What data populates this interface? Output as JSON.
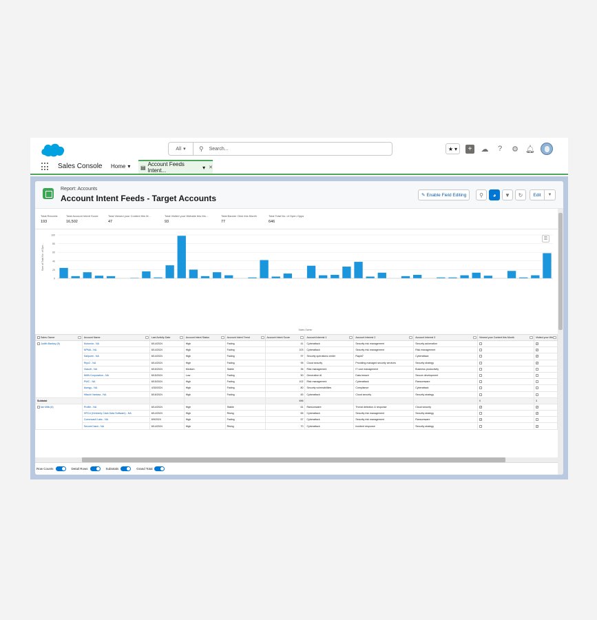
{
  "header": {
    "search_scope": "All",
    "search_placeholder": "Search...",
    "icons": [
      "favorites-star-icon",
      "add-icon",
      "trailhead-icon",
      "help-icon",
      "setup-gear-icon",
      "notification-bell-icon",
      "user-avatar"
    ]
  },
  "nav": {
    "app_name": "Sales Console",
    "home_label": "Home",
    "tab_label": "Account Feeds Intent..."
  },
  "report": {
    "subtitle": "Report: Accounts",
    "title": "Account Intent Feeds - Target Accounts",
    "enable_field_editing": "Enable Field Editing",
    "edit_label": "Edit"
  },
  "summary": [
    {
      "label": "Total Records",
      "value": "193"
    },
    {
      "label": "Total Account Intent Score",
      "value": "16,502"
    },
    {
      "label": "Total Viewed your Content this M...",
      "value": "47"
    },
    {
      "label": "Total Visited your Website this Mo...",
      "value": "93"
    },
    {
      "label": "Total Banner Click this Month",
      "value": "77"
    },
    {
      "label": "Total Total No. of Open Opps",
      "value": "646"
    }
  ],
  "chart_data": {
    "type": "bar",
    "title": "",
    "xlabel": "Sales Owner",
    "ylabel": "Sum of Total No. of Ope...",
    "ylim": [
      0,
      100
    ],
    "yticks": [
      0,
      20,
      40,
      60,
      80,
      100
    ],
    "values": [
      24,
      5,
      14,
      6,
      5,
      0,
      1,
      16,
      2,
      30,
      98,
      20,
      5,
      14,
      7,
      0,
      2,
      42,
      4,
      11,
      0,
      29,
      7,
      8,
      27,
      38,
      4,
      13,
      0,
      5,
      8,
      0,
      2,
      2,
      7,
      13,
      6,
      0,
      17,
      2,
      7,
      58
    ],
    "color": "#1b96dc"
  },
  "table": {
    "columns": [
      "Sales Owner",
      "Account Name",
      "Last Activity Date",
      "Account Intent Status",
      "Account Intent Trend",
      "Account Intent Score",
      "Account Interest 1",
      "Account Interest 2",
      "Account Interest 3",
      "Viewed your Content this Month",
      "Visited your Web"
    ],
    "group1_owner": "Judith Banksy (8)",
    "group1_rows": [
      [
        "Motorola - NA",
        "8/14/2024",
        "High",
        "Fading",
        "41",
        "Cyberattack",
        "Security risk management",
        "Security automation",
        "",
        "x"
      ],
      [
        "NPMA - NA",
        "8/14/2024",
        "High",
        "Fading",
        "103",
        "Cyberattack",
        "Security risk management",
        "Risk management",
        "",
        "x"
      ],
      [
        "Sailpoint - NA",
        "8/14/2024",
        "High",
        "Fading",
        "97",
        "Security operations center",
        "Rapid7",
        "Cyberattack",
        "",
        "x"
      ],
      [
        "Rlyn2 - NA",
        "8/14/2024",
        "High",
        "Fading",
        "95",
        "Cloud security",
        "Providing managed security services",
        "Security strategy",
        "",
        "x"
      ],
      [
        "Viasoft - NA",
        "8/15/2024",
        "Medium",
        "Stable",
        "36",
        "Risk management",
        "IT cost management",
        "Business productivity",
        "",
        ""
      ],
      [
        "NMN Corporation - NA",
        "8/15/2024",
        "Low",
        "Fading",
        "50",
        "Generative AI",
        "Data breach",
        "Secure development",
        "",
        ""
      ],
      [
        "PWC - NA",
        "8/15/2024",
        "High",
        "Fading",
        "102",
        "Risk management",
        "Cyberattack",
        "Ransomware",
        "",
        ""
      ],
      [
        "Asergy - NA",
        "4/30/2024",
        "High",
        "Fading",
        "80",
        "Security vulnerabilities",
        "Compliance",
        "Cyberattack",
        "",
        ""
      ],
      [
        "Hitachi Vantara - NA",
        "8/16/2024",
        "High",
        "Fading",
        "83",
        "Cyberattack",
        "Cloud security",
        "Security strategy",
        "",
        ""
      ]
    ],
    "subtotal_label": "Subtotal",
    "subtotal_score": "696",
    "subtotal_viewed": "0",
    "subtotal_visited": "3",
    "group2_owner": "Ian Mills (6)",
    "group2_rows": [
      [
        "Profile - NA",
        "8/14/2024",
        "High",
        "Stable",
        "61",
        "Ransomware",
        "Threat detection & response",
        "Cloud security",
        "x",
        "x"
      ],
      [
        "HPCU (Kimberly Clark Data Software) - NA",
        "8/14/2024",
        "High",
        "Rising",
        "65",
        "Cyberattack",
        "Security risk management",
        "Security strategy",
        "",
        "x"
      ],
      [
        "Commvault Labs - NA",
        "8/9/2024",
        "High",
        "Fading",
        "57",
        "Cyberattack",
        "Security risk management",
        "Ransomware",
        "x",
        ""
      ],
      [
        "SecureCrash - NA",
        "8/14/2024",
        "High",
        "Rising",
        "70",
        "Cyberattack",
        "Incident response",
        "Security strategy",
        "",
        "x"
      ]
    ]
  },
  "footer": {
    "row_counts": "Row Counts",
    "detail_rows": "Detail Rows",
    "subtotals": "Subtotals",
    "grand_total": "Grand Total"
  }
}
